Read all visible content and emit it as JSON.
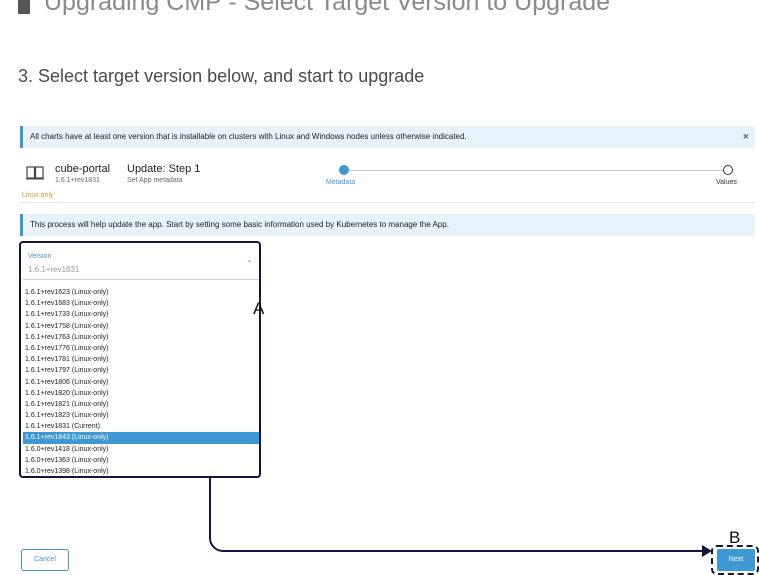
{
  "doc_title": "Upgrading CMP - Select Target Version to Upgrade",
  "step_heading": "3. Select target version below, and start to upgrade",
  "banner_top": {
    "text": "All charts have at least one version that is installable on clusters with Linux and Windows nodes unless otherwise indicated.",
    "close_label": "×"
  },
  "app": {
    "name": "cube-portal",
    "version": "1.6.1+rev1831",
    "os_badge": "Linux only",
    "icon": "book-icon"
  },
  "update": {
    "title": "Update: Step 1",
    "subtitle": "Set App metadata"
  },
  "stepper": {
    "steps": [
      {
        "label": "Metadata",
        "active": true
      },
      {
        "label": "Values",
        "active": false
      }
    ]
  },
  "info_banner": "This process will help update the app. Start by setting some basic information used by Kubernetes to manage the App.",
  "version_select": {
    "label": "Version",
    "value": "1.6.1+rev1831",
    "chevron_icon": "chevron-up-icon",
    "options": [
      "1.6.1+rev1623 (Linux-only)",
      "1.6.1+rev1683 (Linux-only)",
      "1.6.1+rev1733 (Linux-only)",
      "1.6.1+rev1758 (Linux-only)",
      "1.6.1+rev1763 (Linux-only)",
      "1.6.1+rev1776 (Linux-only)",
      "1.6.1+rev1781 (Linux-only)",
      "1.6.1+rev1797 (Linux-only)",
      "1.6.1+rev1806 (Linux-only)",
      "1.6.1+rev1820 (Linux-only)",
      "1.6.1+rev1821 (Linux-only)",
      "1.6.1+rev1823 (Linux-only)",
      "1.6.1+rev1831 (Current)",
      "1.6.1+rev1843 (Linux-only)",
      "1.6.0+rev1418 (Linux-only)",
      "1.6.0+rev1363 (Linux-only)",
      "1.6.0+rev1398 (Linux-only)"
    ],
    "highlighted_option": "1.6.1+rev1843 (Linux-only)"
  },
  "annotations": {
    "marker_a": "A",
    "marker_b": "B"
  },
  "footer": {
    "cancel_label": "Cancel",
    "next_label": "Next"
  },
  "colors": {
    "accent": "#3d98d3",
    "annotation": "#15173a",
    "badge": "#d29b2a"
  }
}
